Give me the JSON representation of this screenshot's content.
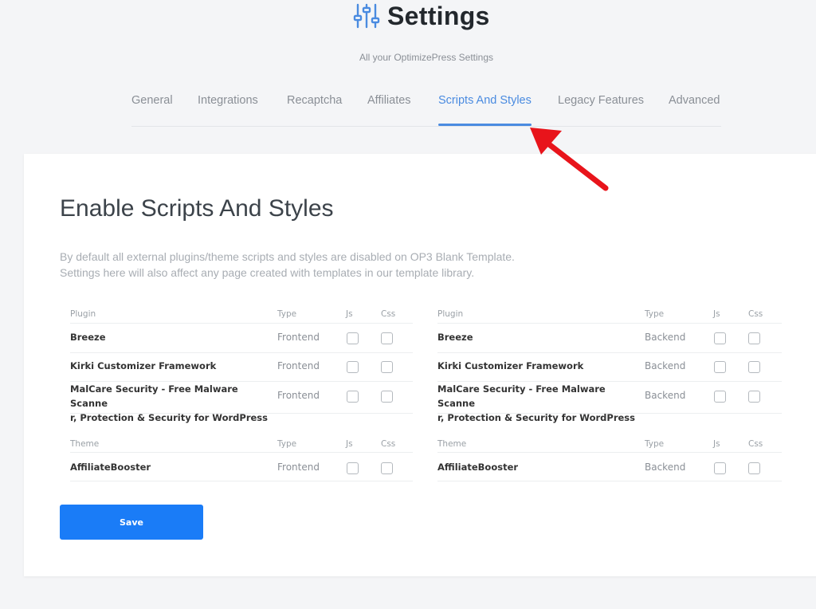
{
  "header": {
    "title": "Settings",
    "subtitle": "All your OptimizePress Settings"
  },
  "tabs": [
    {
      "label": "General"
    },
    {
      "label": "Integrations"
    },
    {
      "label": "Recaptcha"
    },
    {
      "label": "Affiliates"
    },
    {
      "label": "Scripts And Styles"
    },
    {
      "label": "Legacy Features"
    },
    {
      "label": "Advanced"
    }
  ],
  "active_tab": "Scripts And Styles",
  "section": {
    "title": "Enable Scripts And Styles",
    "desc_line1": "By default all external plugins/theme scripts and styles are disabled on OP3 Blank Template.",
    "desc_line2": "Settings here will also affect any page created with templates in our template library."
  },
  "columns": {
    "plugin": "Plugin",
    "theme": "Theme",
    "type": "Type",
    "js": "Js",
    "css": "Css"
  },
  "plugins": [
    {
      "name_line1": "Breeze",
      "name_line2": ""
    },
    {
      "name_line1": "Kirki Customizer Framework",
      "name_line2": ""
    },
    {
      "name_line1": "MalCare Security - Free Malware Scanne",
      "name_line2": "r, Protection & Security for WordPress"
    }
  ],
  "themes": [
    {
      "name_line1": "AffiliateBooster"
    }
  ],
  "types": {
    "left": "Frontend",
    "right": "Backend"
  },
  "save_label": "Save",
  "colors": {
    "accent": "#4a8be0",
    "save_button": "#1a7cf7",
    "arrow": "#e8141b"
  }
}
